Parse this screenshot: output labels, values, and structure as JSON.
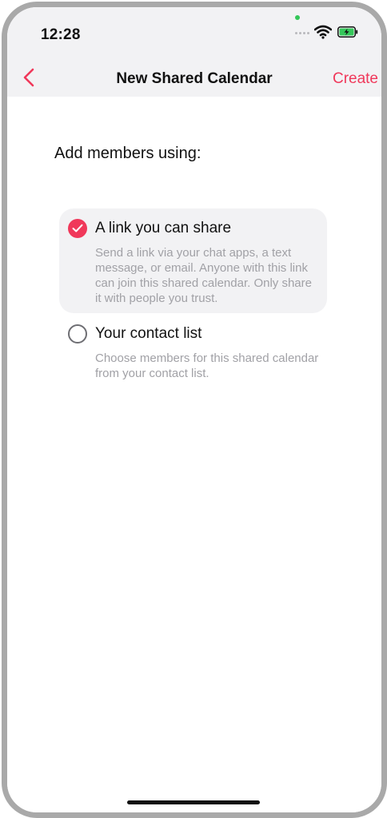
{
  "status_bar": {
    "time": "12:28",
    "icons": [
      "camera-indicator-dot",
      "signal-dots-icon",
      "wifi-icon",
      "battery-charging-icon"
    ],
    "camera_dot_color": "#34c759"
  },
  "nav": {
    "back_icon": "chevron-left-icon",
    "title": "New Shared Calendar",
    "create_label": "Create",
    "accent_color": "#f0385a"
  },
  "main": {
    "section_title": "Add members using:",
    "options": [
      {
        "label": "A link you can share",
        "description": "Send a link via your chat apps, a text message, or email. Anyone with this link can join this shared calendar. Only share it with people you trust.",
        "selected": true
      },
      {
        "label": "Your contact list",
        "description": "Choose members for this shared calendar from your contact list.",
        "selected": false
      }
    ]
  }
}
